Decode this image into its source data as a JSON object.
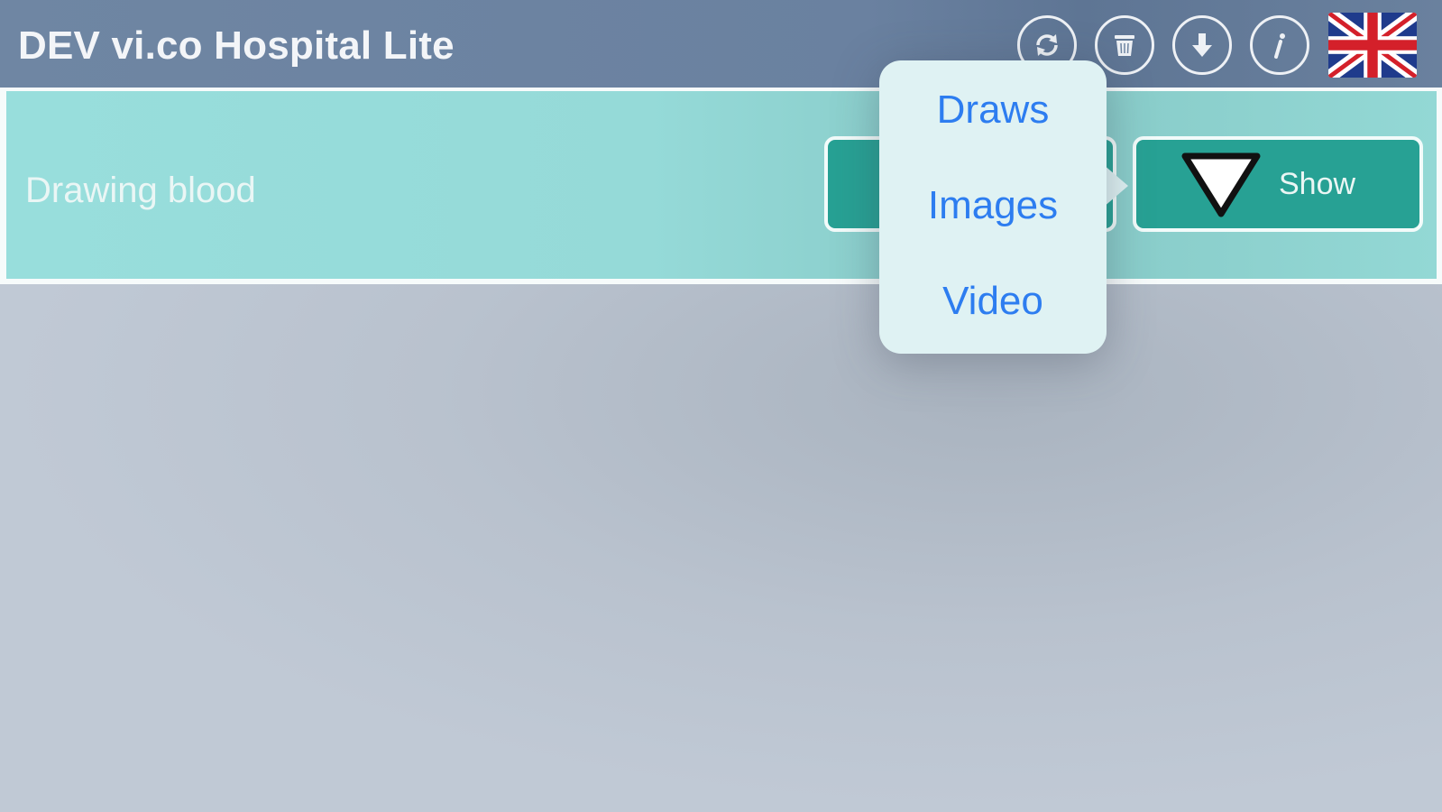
{
  "app": {
    "title": "DEV vi.co Hospital Lite"
  },
  "header": {
    "buttons": [
      {
        "name": "refresh-icon"
      },
      {
        "name": "trash-icon"
      },
      {
        "name": "download-icon"
      },
      {
        "name": "info-icon"
      }
    ],
    "language_flag": "uk-flag-icon"
  },
  "row": {
    "label": "Drawing blood",
    "show_button_label": "Show"
  },
  "popover_menu": {
    "items": [
      "Draws",
      "Images",
      "Video"
    ]
  },
  "colors": {
    "header": "#6f86a3",
    "row_background": "#98dedc",
    "button_teal": "#27a194",
    "menu_text": "#2d7df0",
    "popover_bg": "#dff2f3"
  }
}
